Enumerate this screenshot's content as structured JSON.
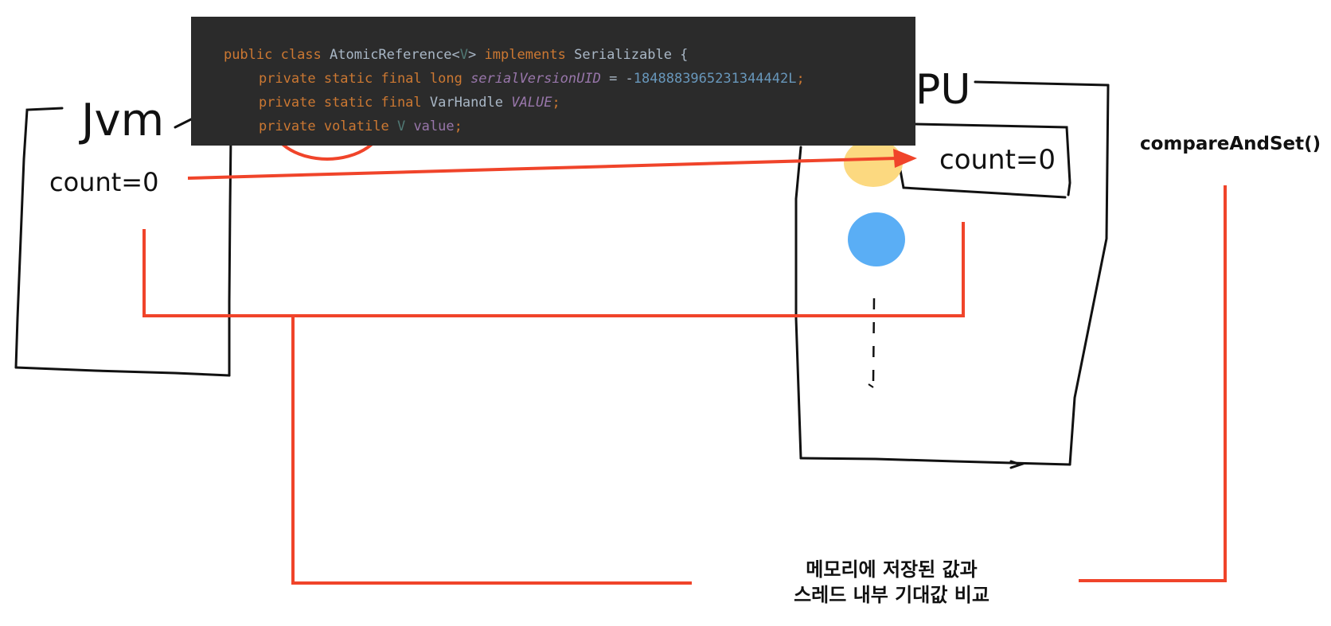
{
  "code": {
    "line1": {
      "kw1": "public class ",
      "cls": "AtomicReference",
      "gen_open": "<",
      "gen": "V",
      "gen_close": "> ",
      "kw2": "implements ",
      "iface": "Serializable {"
    },
    "line2": {
      "kw": "private static final long ",
      "field": "serialVersionUID",
      "op": " = -",
      "num": "1848883965231344442L",
      "semi": ";"
    },
    "line3": {
      "kw": "private static final ",
      "type": "VarHandle ",
      "field": "VALUE",
      "semi": ";"
    },
    "line4": {
      "kw": "private volatile ",
      "type": "V ",
      "field": "value",
      "semi": ";"
    }
  },
  "diagram": {
    "jvm_label": "Jvm",
    "jvm_var": "count=0",
    "cpu_label": "PU",
    "cpu_var": "count=0"
  },
  "method_label": "compareAndSet()",
  "caption": {
    "line1": "메모리에 저장된 값과",
    "line2": "스레드 내부 기대값 비교"
  },
  "colors": {
    "accent_red": "#f0442a",
    "yellow_dot": "#fcd980",
    "blue_dot": "#5aaef5",
    "code_bg": "#2b2b2b"
  }
}
